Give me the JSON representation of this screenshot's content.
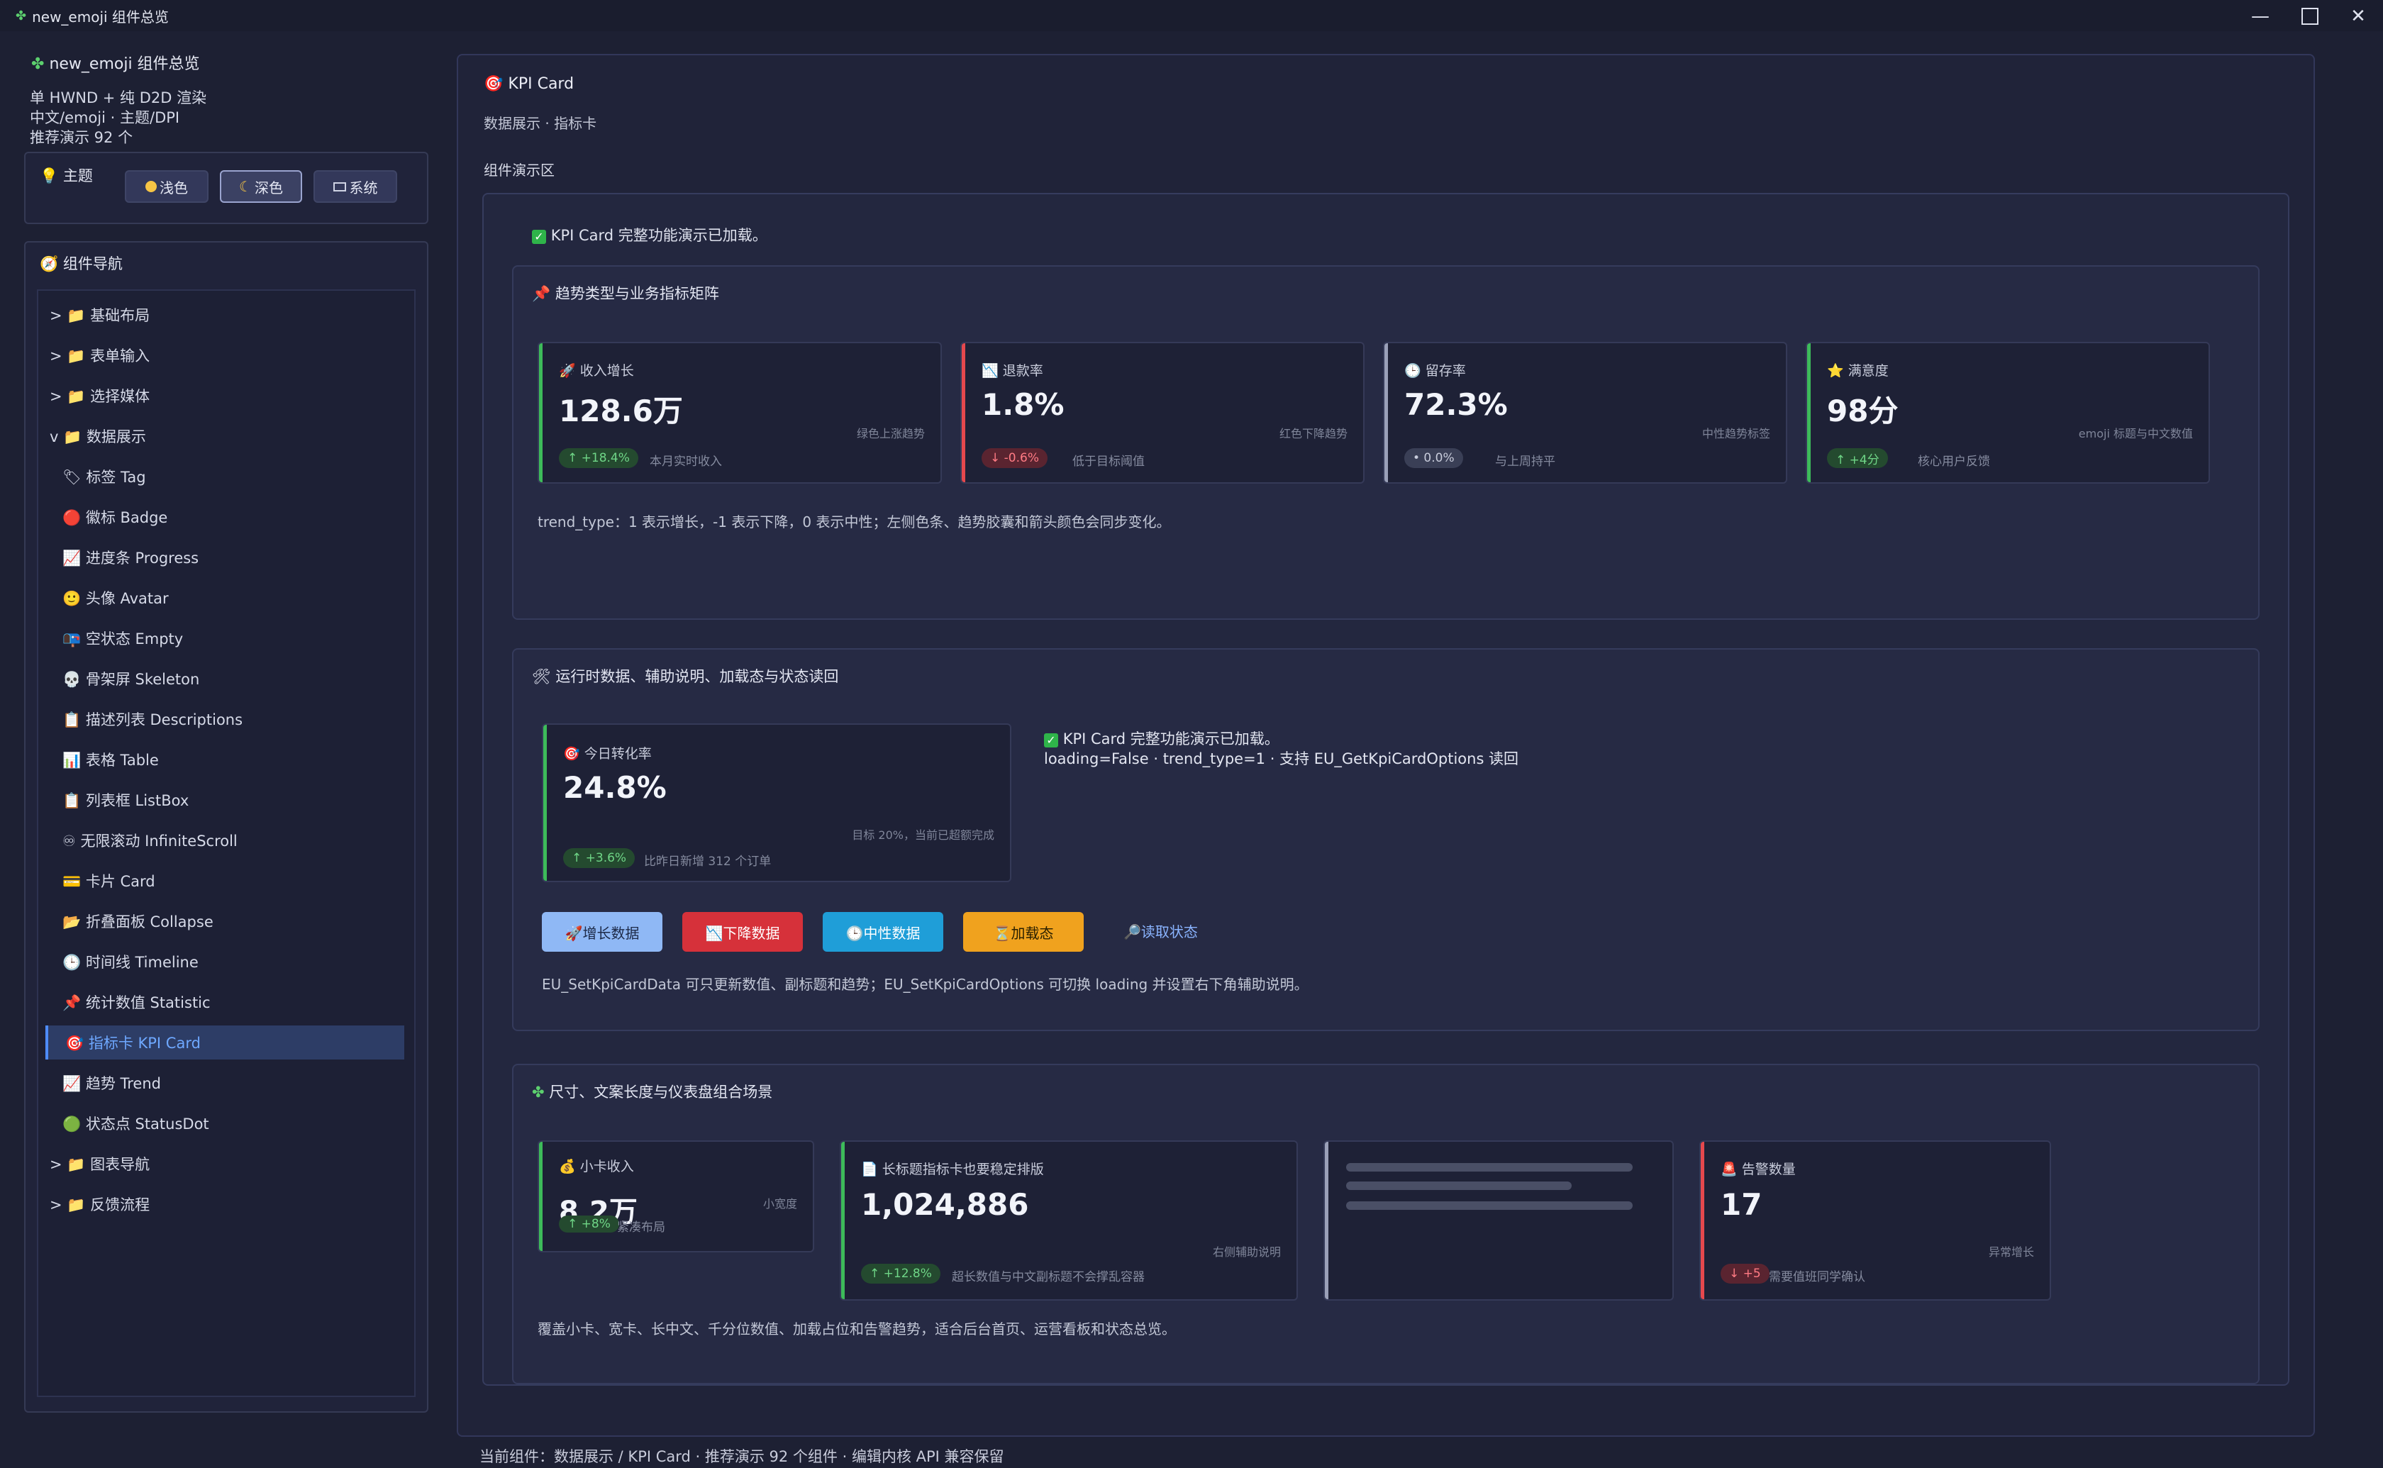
{
  "window": {
    "title": "new_emoji 组件总览"
  },
  "sidebar": {
    "app_title": "new_emoji 组件总览",
    "desc_lines": [
      "单 HWND + 纯 D2D 渲染",
      "中文/emoji · 主题/DPI",
      "推荐演示 92 个"
    ],
    "theme": {
      "title": "主题",
      "buttons": [
        "浅色",
        "深色",
        "系统"
      ],
      "active": "深色"
    },
    "nav_title": "组件导航",
    "nav": [
      {
        "label": "> 📁 基础布局",
        "level": 0
      },
      {
        "label": "> 📁 表单输入",
        "level": 0
      },
      {
        "label": "> 📁 选择媒体",
        "level": 0
      },
      {
        "label": "v 📁 数据展示",
        "level": 0
      },
      {
        "label": "🏷 标签 Tag",
        "level": 1
      },
      {
        "label": "🔴 徽标 Badge",
        "level": 1
      },
      {
        "label": "📈 进度条 Progress",
        "level": 1
      },
      {
        "label": "🙂 头像 Avatar",
        "level": 1
      },
      {
        "label": "📭 空状态 Empty",
        "level": 1
      },
      {
        "label": "💀 骨架屏 Skeleton",
        "level": 1
      },
      {
        "label": "📋 描述列表 Descriptions",
        "level": 1
      },
      {
        "label": "📊 表格 Table",
        "level": 1
      },
      {
        "label": "📋 列表框 ListBox",
        "level": 1
      },
      {
        "label": "♾ 无限滚动 InfiniteScroll",
        "level": 1
      },
      {
        "label": "💳 卡片 Card",
        "level": 1
      },
      {
        "label": "📂 折叠面板 Collapse",
        "level": 1
      },
      {
        "label": "🕒 时间线 Timeline",
        "level": 1
      },
      {
        "label": "📌 统计数值 Statistic",
        "level": 1
      },
      {
        "label": "🎯 指标卡 KPI Card",
        "level": 1,
        "active": true
      },
      {
        "label": "📈 趋势 Trend",
        "level": 1
      },
      {
        "label": "🟢 状态点 StatusDot",
        "level": 1
      },
      {
        "label": "> 📁 图表导航",
        "level": 0
      },
      {
        "label": "> 📁 反馈流程",
        "level": 0
      }
    ]
  },
  "main": {
    "title": "KPI Card",
    "subtitle": "数据展示 · 指标卡",
    "demo_label": "组件演示区",
    "loaded_msg": "KPI Card 完整功能演示已加载。",
    "section1": {
      "title": "趋势类型与业务指标矩阵",
      "cards": [
        {
          "label": "收入增长",
          "value": "128.6万",
          "sub": "绿色上涨趋势",
          "trend": "↑ +18.4%",
          "trend_kind": "up",
          "note": "本月实时收入",
          "color": "#3dbb5a",
          "icon": "rocket-icon",
          "glyph": "🚀"
        },
        {
          "label": "退款率",
          "value": "1.8%",
          "sub": "红色下降趋势",
          "trend": "↓ -0.6%",
          "trend_kind": "down",
          "note": "低于目标阈值",
          "color": "#e5484d",
          "icon": "chart-down-icon",
          "glyph": "📉"
        },
        {
          "label": "留存率",
          "value": "72.3%",
          "sub": "中性趋势标签",
          "trend": "• 0.0%",
          "trend_kind": "flat",
          "note": "与上周持平",
          "color": "#9aa0b8",
          "icon": "clock-icon",
          "glyph": "🕒"
        },
        {
          "label": "满意度",
          "value": "98分",
          "sub": "emoji 标题与中文数值",
          "trend": "↑ +4分",
          "trend_kind": "up",
          "note": "核心用户反馈",
          "color": "#3dbb5a",
          "icon": "star-icon",
          "glyph": "⭐"
        }
      ],
      "desc": "trend_type：1 表示增长，-1 表示下降，0 表示中性；左侧色条、趋势胶囊和箭头颜色会同步变化。"
    },
    "section2": {
      "title": "运行时数据、辅助说明、加载态与状态读回",
      "card": {
        "label": "今日转化率",
        "value": "24.8%",
        "sub": "目标 20%，当前已超额完成",
        "trend": "↑ +3.6%",
        "note": "比昨日新增 312 个订单",
        "glyph": "🎯"
      },
      "status_line1": "KPI Card 完整功能演示已加载。",
      "status_line2": "loading=False · trend_type=1 · 支持 EU_GetKpiCardOptions 读回",
      "buttons": [
        {
          "label": "🚀增长数据",
          "color": "#8fb8f5",
          "fg": "#1d2a48"
        },
        {
          "label": "📉下降数据",
          "color": "#d6313a",
          "fg": "#ffffff"
        },
        {
          "label": "🕒中性数据",
          "color": "#1f9ed8",
          "fg": "#ffffff"
        },
        {
          "label": "⏳加载态",
          "color": "#f0a21e",
          "fg": "#2a2000"
        }
      ],
      "read_label": "🔎读取状态",
      "desc": "EU_SetKpiCardData 可只更新数值、副标题和趋势；EU_SetKpiCardOptions 可切换 loading 并设置右下角辅助说明。"
    },
    "section3": {
      "title": "尺寸、文案长度与仪表盘组合场景",
      "small": {
        "label": "小卡收入",
        "value": "8.2万",
        "sub": "小宽度",
        "trend": "↑ +8%",
        "note": "紧凑布局",
        "glyph": "💰"
      },
      "wide": {
        "label": "长标题指标卡也要稳定排版",
        "value": "1,024,886",
        "sub": "右侧辅助说明",
        "trend": "↑ +12.8%",
        "note": "超长数值与中文副标题不会撑乱容器",
        "glyph": "📄"
      },
      "alert": {
        "label": "告警数量",
        "value": "17",
        "sub": "异常增长",
        "trend": "↓ +5",
        "note": "需要值班同学确认",
        "glyph": "🚨"
      },
      "desc": "覆盖小卡、宽卡、长中文、千分位数值、加载占位和告警趋势，适合后台首页、运营看板和状态总览。"
    }
  },
  "statusbar": {
    "text": "当前组件：数据展示 / KPI Card · 推荐演示 92 个组件 · 编辑内核 API 兼容保留"
  }
}
